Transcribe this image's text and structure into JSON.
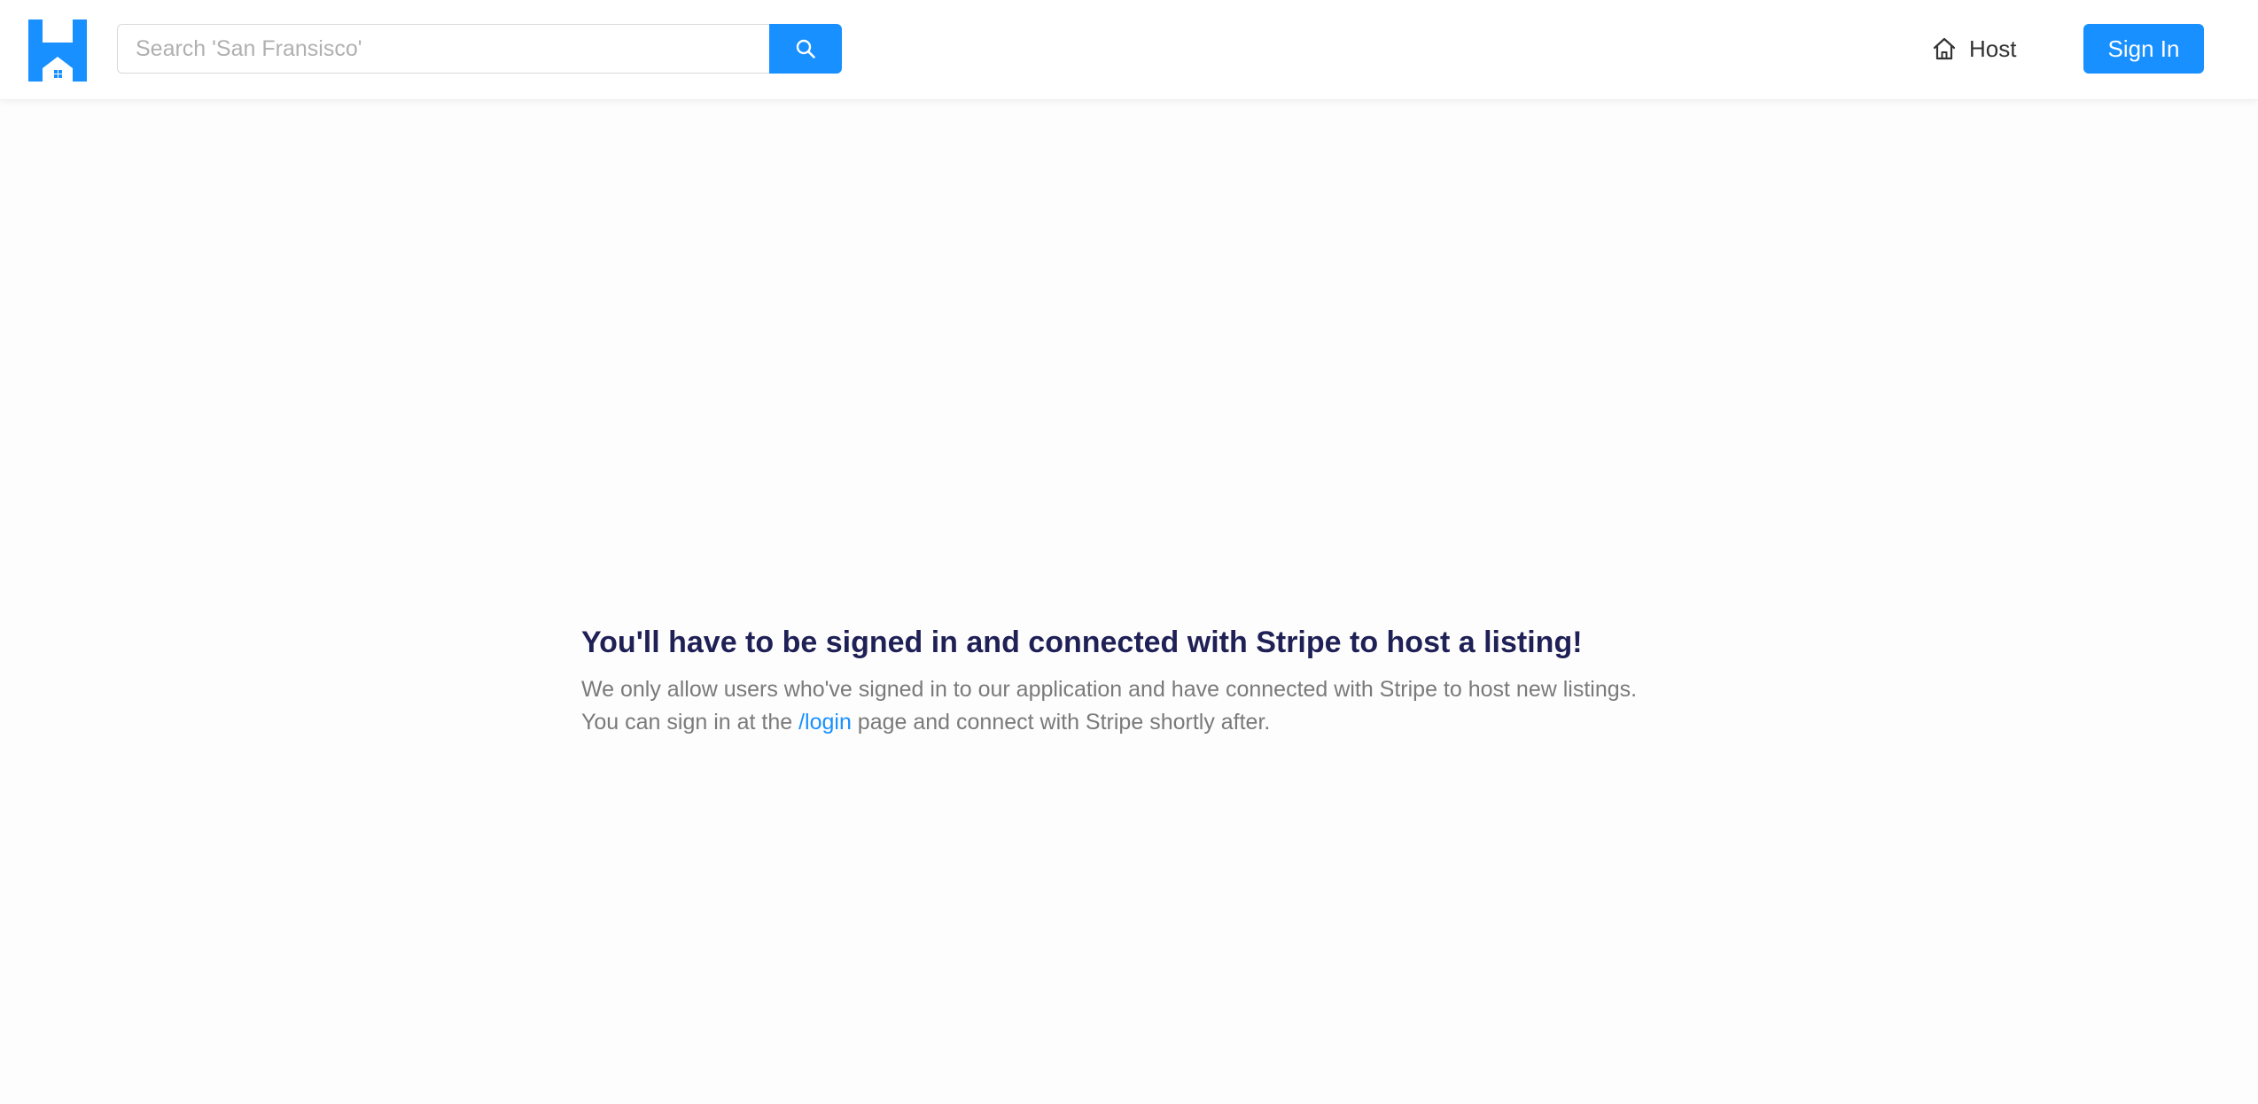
{
  "header": {
    "search": {
      "placeholder": "Search 'San Fransisco'",
      "button_icon": "search-icon"
    },
    "host": {
      "icon": "home-icon",
      "label": "Host"
    },
    "sign_in_label": "Sign In"
  },
  "main": {
    "title": "You'll have to be signed in and connected with Stripe to host a listing!",
    "description_line1": "We only allow users who've signed in to our application and have connected with Stripe to host new listings.",
    "description_line2_before": "You can sign in at the ",
    "login_link": "/login",
    "description_line2_after": " page and connect with Stripe shortly after."
  },
  "colors": {
    "accent": "#1890ff",
    "title": "#1f2156",
    "body_text": "#7a7a7a",
    "background": "#fefdfe"
  }
}
